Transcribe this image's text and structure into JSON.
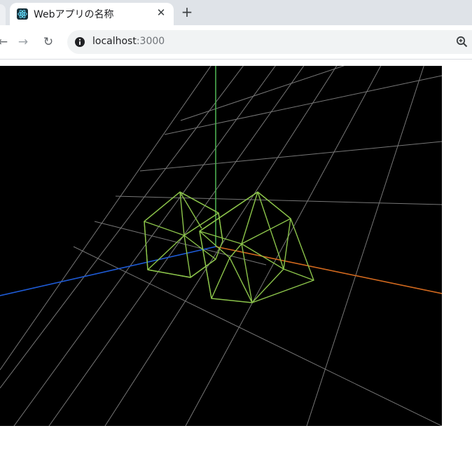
{
  "browser": {
    "tab": {
      "title": "Webアプリの名称",
      "close_glyph": "✕"
    },
    "new_tab_glyph": "+",
    "toolbar": {
      "back_glyph": "←",
      "forward_glyph": "→",
      "reload_glyph": "↻"
    },
    "address": {
      "host": "localhost",
      "port": ":3000"
    },
    "icons": {
      "favicon": "react-atom-icon",
      "site_info": "info-circle-icon",
      "zoom": "zoom-magnifier-icon"
    }
  },
  "scene": {
    "type": "three.js wireframe scene",
    "background": "#000000",
    "grid_color": "#8c8c8c",
    "wireframe_color": "#8bc34a",
    "axes": {
      "x_color": "#d2691e",
      "y_color": "#4caf50",
      "z_color": "#1e5bd6"
    },
    "objects": [
      "wireframe-icosahedron",
      "wireframe-icosahedron"
    ]
  }
}
